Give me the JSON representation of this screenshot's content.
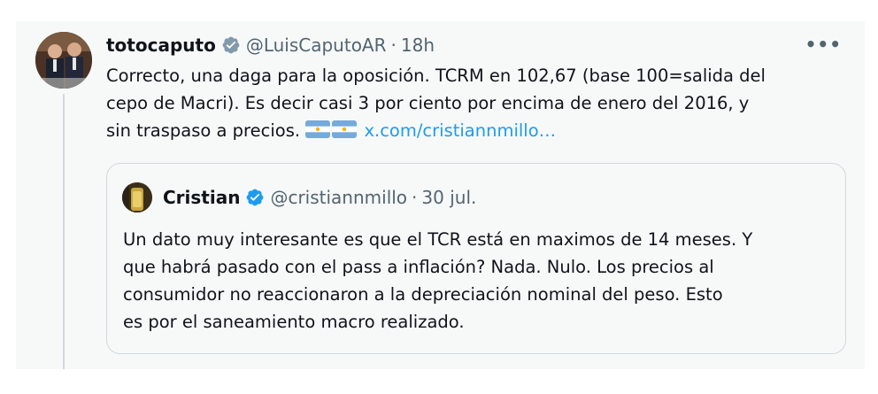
{
  "tweet": {
    "display_name": "totocaputo",
    "handle": "@LuisCaputoAR",
    "separator": "·",
    "time": "18h",
    "more_label": "•••",
    "text_lines": [
      "Correcto, una daga para la oposición. TCRM en 102,67 (base 100=salida del",
      "cepo de Macri). Es decir casi 3 por ciento por encima de enero del 2016, y",
      "sin traspaso a precios. "
    ],
    "flags": [
      "argentina-flag",
      "argentina-flag"
    ],
    "link_text": "x.com/cristiannmillo…"
  },
  "quote": {
    "display_name": "Cristian",
    "handle": "@cristiannmillo",
    "separator": "·",
    "time": "30 jul.",
    "text_lines": [
      "Un dato muy interesante es que el TCR está en maximos de 14 meses. Y",
      "que habrá pasado con el pass a inflación? Nada. Nulo. Los precios al",
      "consumidor no reaccionaron a la depreciación nominal del peso. Esto",
      "es por el saneamiento macro realizado."
    ]
  },
  "colors": {
    "background": "#f7f9f9",
    "text": "#0f1419",
    "secondary_text": "#536471",
    "link": "#1d9bf0",
    "verified_badge": "#1d9bf0",
    "border": "#cfd9de"
  }
}
